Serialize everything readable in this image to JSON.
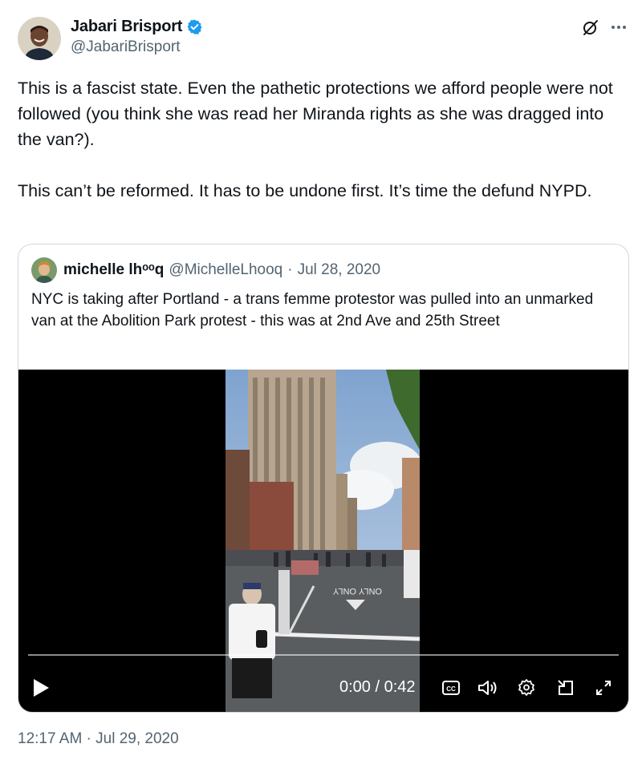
{
  "author": {
    "name": "Jabari Brisport",
    "handle": "@JabariBrisport"
  },
  "icons": {
    "verified": "verified-badge-icon",
    "grok": "grok-icon",
    "more": "more-icon"
  },
  "tweet": {
    "text": "This is a fascist state. Even the pathetic protections we afford people were not followed (you think she was read her Miranda rights as she was dragged into the van?).\n\nThis can’t be reformed. It has to be undone first. It’s time the defund NYPD.",
    "timestamp": "12:17 AM · Jul 29, 2020"
  },
  "quote": {
    "name": "michelle lhᵒᵒq",
    "handle": "@MichelleLhooq",
    "separator": "·",
    "date": "Jul 28, 2020",
    "text": "NYC is taking after Portland - a trans femme protestor was pulled into an unmarked van at the Abolition Park protest - this was at 2nd Ave and 25th Street"
  },
  "video": {
    "time": "0:00 / 0:42",
    "progress": 0
  },
  "colors": {
    "verified": "#1d9bf0",
    "text": "#0f1419",
    "muted": "#536471",
    "border": "#cfd9de"
  }
}
